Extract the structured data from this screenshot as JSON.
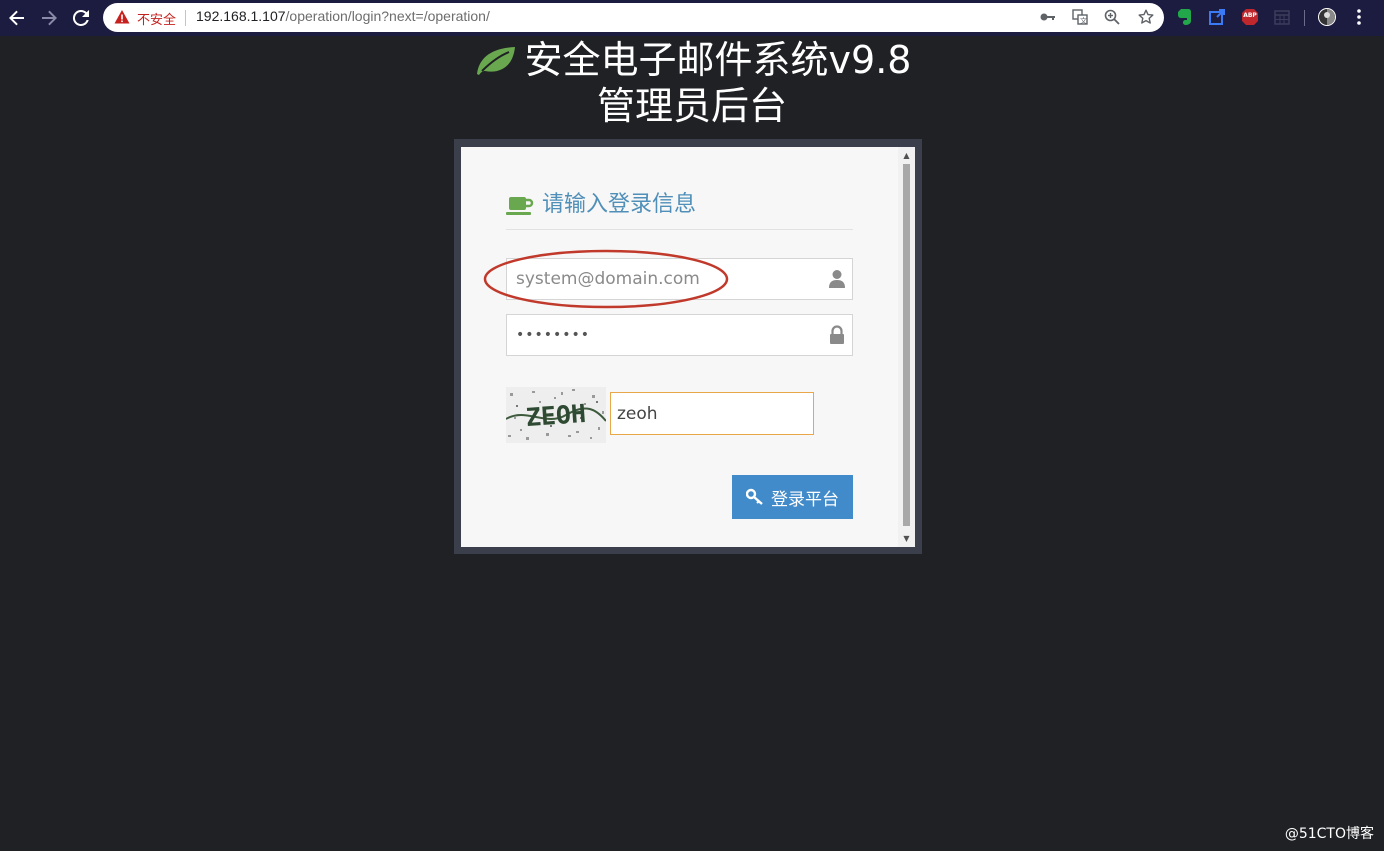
{
  "browser": {
    "back_icon": "arrow-left-icon",
    "forward_icon": "arrow-right-icon",
    "reload_icon": "reload-icon",
    "security_label": "不安全",
    "url_host": "192.168.1.107",
    "url_path": "/operation/login?next=/operation/",
    "omnibox_icons": [
      "key-icon",
      "translate-icon",
      "zoom-icon",
      "star-icon"
    ],
    "extension_icons": [
      "evernote-icon",
      "share-icon",
      "adblock-icon",
      "calendar-icon",
      "profile-icon",
      "menu-icon"
    ],
    "adblock_label": "ABP",
    "colors": {
      "toolbar": "#1c1b40",
      "insecure": "#c5221f"
    }
  },
  "header": {
    "title": "安全电子邮件系统v9.8",
    "subtitle": "管理员后台",
    "logo_icon": "leaf-icon",
    "logo_color": "#6aa84f"
  },
  "login": {
    "section_icon": "coffee-cup-icon",
    "section_title": "请输入登录信息",
    "username": {
      "value": "",
      "placeholder": "system@domain.com",
      "icon": "user-icon"
    },
    "password": {
      "value": "••••••••",
      "icon": "lock-icon"
    },
    "captcha": {
      "image_text": "ZEOH",
      "value": "zeoh"
    },
    "submit_label": "登录平台",
    "submit_icon": "key-icon",
    "colors": {
      "title": "#4f8fb8",
      "button": "#428bca",
      "captcha_border": "#e8a84a",
      "annotation": "#c0392b"
    }
  },
  "watermark": "@51CTO博客"
}
